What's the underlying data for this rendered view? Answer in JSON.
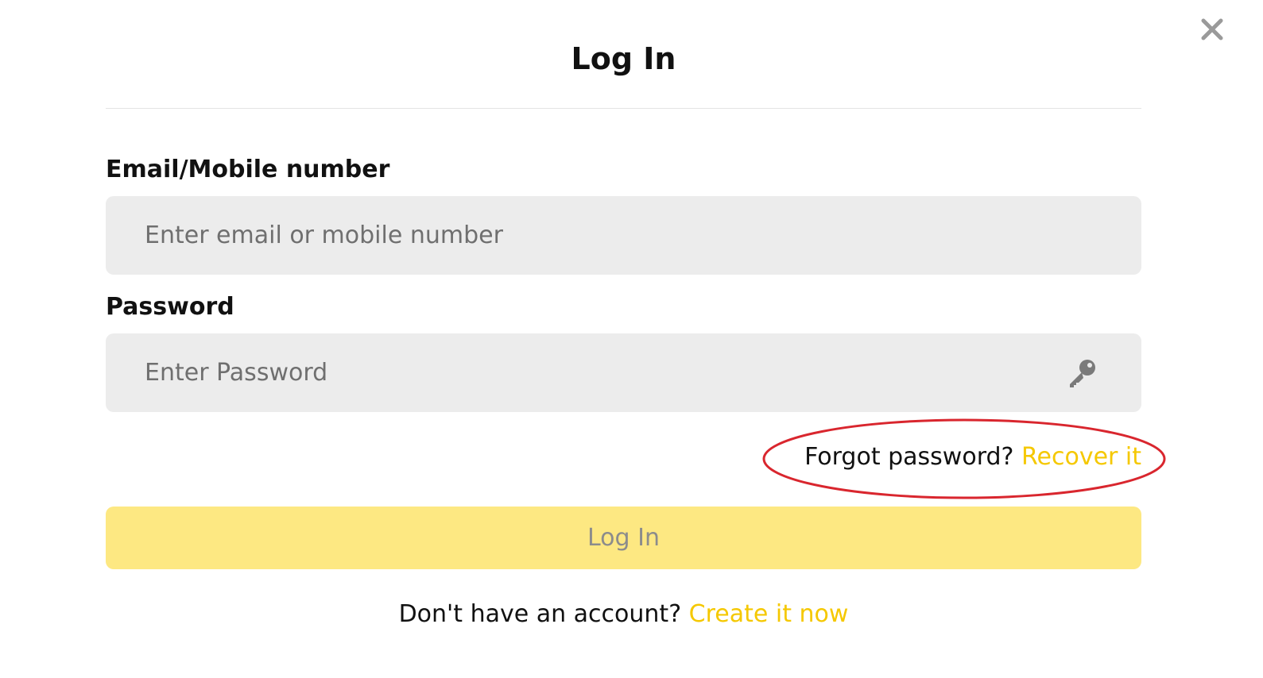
{
  "dialog": {
    "title": "Log In",
    "close_icon": "close-icon"
  },
  "email": {
    "label": "Email/Mobile number",
    "placeholder": "Enter email or mobile number",
    "value": ""
  },
  "password": {
    "label": "Password",
    "placeholder": "Enter Password",
    "value": "",
    "icon": "key-icon"
  },
  "forgot": {
    "prompt": "Forgot password?",
    "link": "Recover it"
  },
  "login_button": {
    "label": "Log In"
  },
  "signup": {
    "prompt": "Don't have an account?",
    "link": "Create it now"
  },
  "colors": {
    "accent": "#f5c800",
    "button_bg": "#fde882",
    "field_bg": "#ececec",
    "annotation": "#d9262e"
  }
}
